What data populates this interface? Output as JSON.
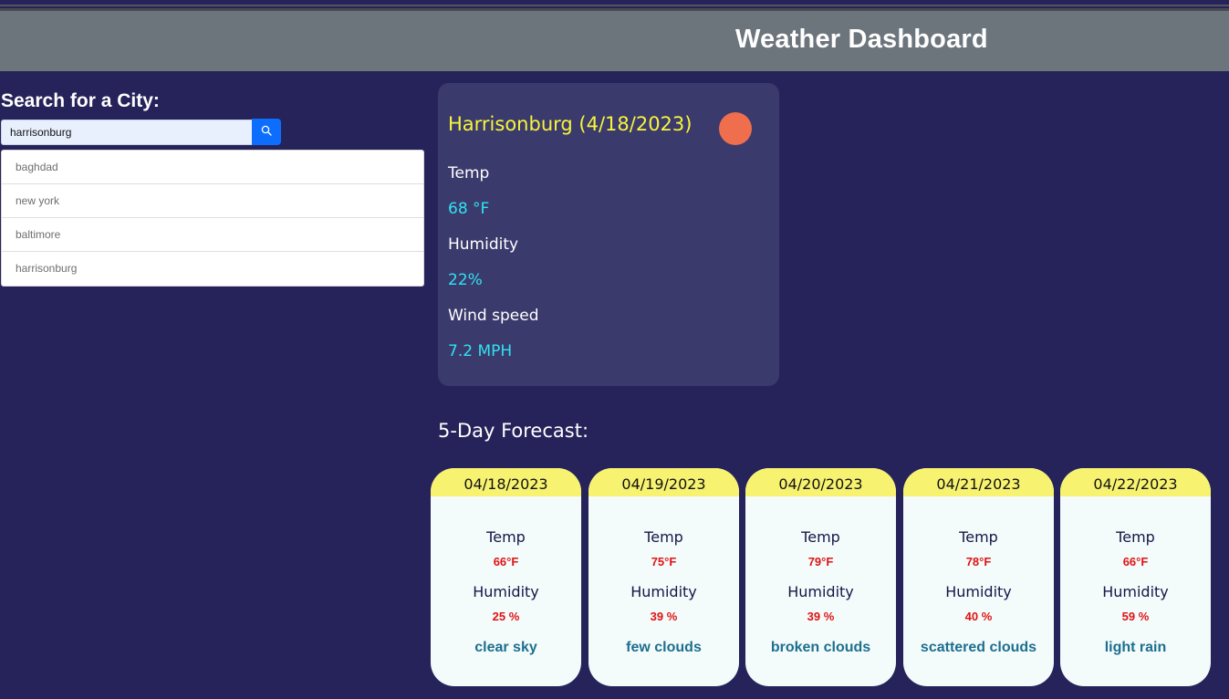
{
  "header": {
    "title": "Weather Dashboard"
  },
  "search": {
    "label": "Search for a City:",
    "value": "harrisonburg",
    "button_icon": "search-icon",
    "history": [
      "baghdad",
      "new york",
      "baltimore",
      "harrisonburg"
    ]
  },
  "current": {
    "city_date": "Harrisonburg (4/18/2023)",
    "icon": "sun-icon",
    "temp_label": "Temp",
    "temp_value": "68 °F",
    "humidity_label": "Humidity",
    "humidity_value": "22%",
    "wind_label": "Wind speed",
    "wind_value": "7.2 MPH"
  },
  "forecast": {
    "title": "5-Day Forecast:",
    "days": [
      {
        "date": "04/18/2023",
        "temp_label": "Temp",
        "temp": "66°F",
        "humidity_label": "Humidity",
        "humidity": "25 %",
        "desc": "clear sky"
      },
      {
        "date": "04/19/2023",
        "temp_label": "Temp",
        "temp": "75°F",
        "humidity_label": "Humidity",
        "humidity": "39 %",
        "desc": "few clouds"
      },
      {
        "date": "04/20/2023",
        "temp_label": "Temp",
        "temp": "79°F",
        "humidity_label": "Humidity",
        "humidity": "39 %",
        "desc": "broken clouds"
      },
      {
        "date": "04/21/2023",
        "temp_label": "Temp",
        "temp": "78°F",
        "humidity_label": "Humidity",
        "humidity": "40 %",
        "desc": "scattered clouds"
      },
      {
        "date": "04/22/2023",
        "temp_label": "Temp",
        "temp": "66°F",
        "humidity_label": "Humidity",
        "humidity": "59 %",
        "desc": "light rain"
      }
    ]
  },
  "colors": {
    "background": "#26235a",
    "header": "#6c747c",
    "card": "#3b3a6c",
    "city_text": "#f7f53a",
    "value_text": "#2fe3f0",
    "forecast_header": "#f7f270",
    "forecast_value": "#e01414",
    "forecast_desc": "#1d6f8f",
    "button": "#0d6efd",
    "sun": "#ee6e4e"
  }
}
